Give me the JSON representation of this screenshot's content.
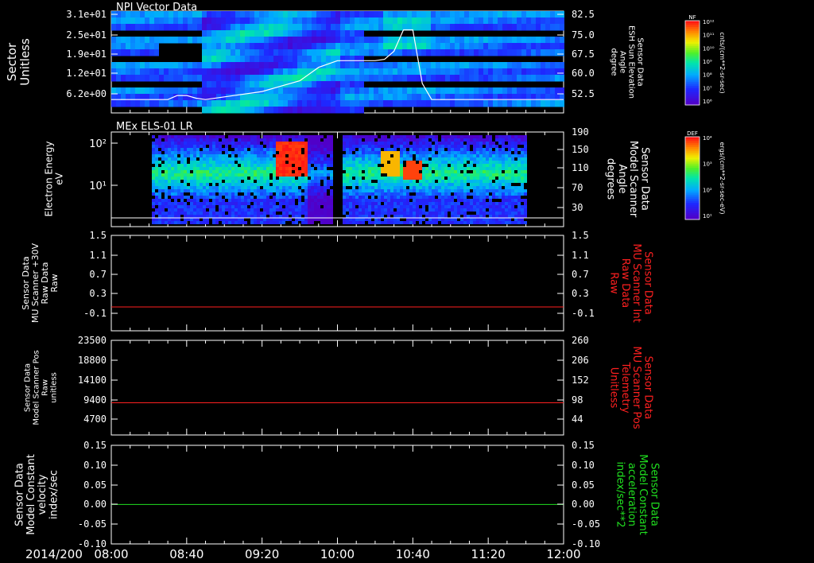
{
  "colors": {
    "white": "#ffffff",
    "red": "#ff2020",
    "green": "#20e020",
    "background": "#000000"
  },
  "date_label": "2014/200",
  "time_axis": {
    "range": [
      "08:00",
      "12:00"
    ],
    "ticks": [
      "08:00",
      "08:40",
      "09:20",
      "10:00",
      "10:40",
      "11:20",
      "12:00"
    ]
  },
  "chart_data": [
    {
      "type": "heatmap",
      "title": "NPI Vector Data",
      "ylabel": [
        "Sector",
        "Unitless"
      ],
      "yticks": [
        "3.1e+01",
        "2.5e+01",
        "1.9e+01",
        "1.2e+01",
        "6.2e+00"
      ],
      "y2label": [
        "Sensor Data",
        "ESH Sun Elevation",
        "Angle",
        "degree"
      ],
      "y2ticks": [
        "82.5",
        "75.0",
        "67.5",
        "60.0",
        "52.5"
      ],
      "y2lim": [
        47,
        85
      ],
      "colorbar": {
        "label": "NF",
        "units": "cnts/(cm**2-sr-sec)",
        "ticks": [
          "10¹²",
          "10¹¹",
          "10¹⁰",
          "10⁹",
          "10⁸",
          "10⁷",
          "10⁶"
        ]
      },
      "series": [
        {
          "x": [
            "08:00",
            "08:20",
            "08:30",
            "08:35",
            "08:40",
            "08:45",
            "08:50",
            "09:00",
            "09:20",
            "09:30",
            "09:40",
            "09:50",
            "10:00",
            "10:10",
            "10:20",
            "10:25",
            "10:30",
            "10:35",
            "10:40",
            "10:45",
            "10:50",
            "11:00",
            "11:20",
            "12:00"
          ],
          "values": [
            52,
            52,
            52,
            53.5,
            53.5,
            52.5,
            52,
            53,
            55,
            57,
            59,
            64,
            66.5,
            66.5,
            66.5,
            67,
            70,
            78,
            78,
            58,
            52,
            52,
            52,
            52
          ],
          "color": "#ffffff"
        }
      ]
    },
    {
      "type": "heatmap",
      "title": "MEx ELS-01 LR",
      "ylabel": [
        "Electron Energy",
        "eV"
      ],
      "yticks": [
        "10²",
        "10¹"
      ],
      "y2label": [
        "Sensor Data",
        "Model Scanner",
        "Angle",
        "degrees"
      ],
      "y2ticks": [
        "190",
        "150",
        "110",
        "70",
        "30"
      ],
      "y2lim": [
        0,
        190
      ],
      "colorbar": {
        "label": "DEF",
        "units": "ergs/(cm**2-sr-sec-eV)",
        "ticks": [
          "10⁴",
          "10³",
          "10²",
          "10¹"
        ]
      },
      "series": [
        {
          "x": [
            "08:00",
            "12:00"
          ],
          "values": [
            10,
            10
          ],
          "color": "#ffffff"
        }
      ]
    },
    {
      "type": "line",
      "ylabel": [
        "Sensor Data",
        "MU Scanner +30V",
        "Raw Data",
        "Raw"
      ],
      "yticks": [
        "1.5",
        "1.1",
        "0.7",
        "0.3",
        "-0.1"
      ],
      "ylim": [
        -0.5,
        1.5
      ],
      "y2label": [
        "Sensor Data",
        "MU Scanner Int",
        "Raw Data",
        "Raw"
      ],
      "y2ticks": [
        "1.5",
        "1.1",
        "0.7",
        "0.3",
        "-0.1"
      ],
      "series": [
        {
          "x": [
            "08:00",
            "12:00"
          ],
          "values": [
            0.0,
            0.0
          ],
          "color": "#ff2020"
        }
      ]
    },
    {
      "type": "line",
      "ylabel": [
        "Sensor Data",
        "Model Scanner Pos",
        "Raw",
        "unitless"
      ],
      "yticks": [
        "23500",
        "18800",
        "14100",
        "9400",
        "4700"
      ],
      "ylim": [
        0,
        23500
      ],
      "y2label": [
        "Sensor Data",
        "MU Scanner Pos",
        "Telemetry",
        "Unitless"
      ],
      "y2ticks": [
        "260",
        "206",
        "152",
        "98",
        "44"
      ],
      "series": [
        {
          "x": [
            "08:00",
            "12:00"
          ],
          "values": [
            8000,
            8000
          ],
          "color": "#ff2020"
        }
      ]
    },
    {
      "type": "line",
      "ylabel": [
        "Sensor Data",
        "Model Constant",
        "velocity",
        "index/sec"
      ],
      "yticks": [
        "0.15",
        "0.10",
        "0.05",
        "0.00",
        "-0.05",
        "-0.10"
      ],
      "ylim": [
        -0.1,
        0.15
      ],
      "y2label": [
        "Sensor Data",
        "Model Constant",
        "acceleration",
        "index/sec**2"
      ],
      "y2ticks": [
        "0.15",
        "0.10",
        "0.05",
        "0.00",
        "-0.05",
        "-0.10"
      ],
      "series": [
        {
          "x": [
            "08:00",
            "12:00"
          ],
          "values": [
            0.0,
            0.0
          ],
          "color": "#20e020"
        }
      ]
    }
  ]
}
